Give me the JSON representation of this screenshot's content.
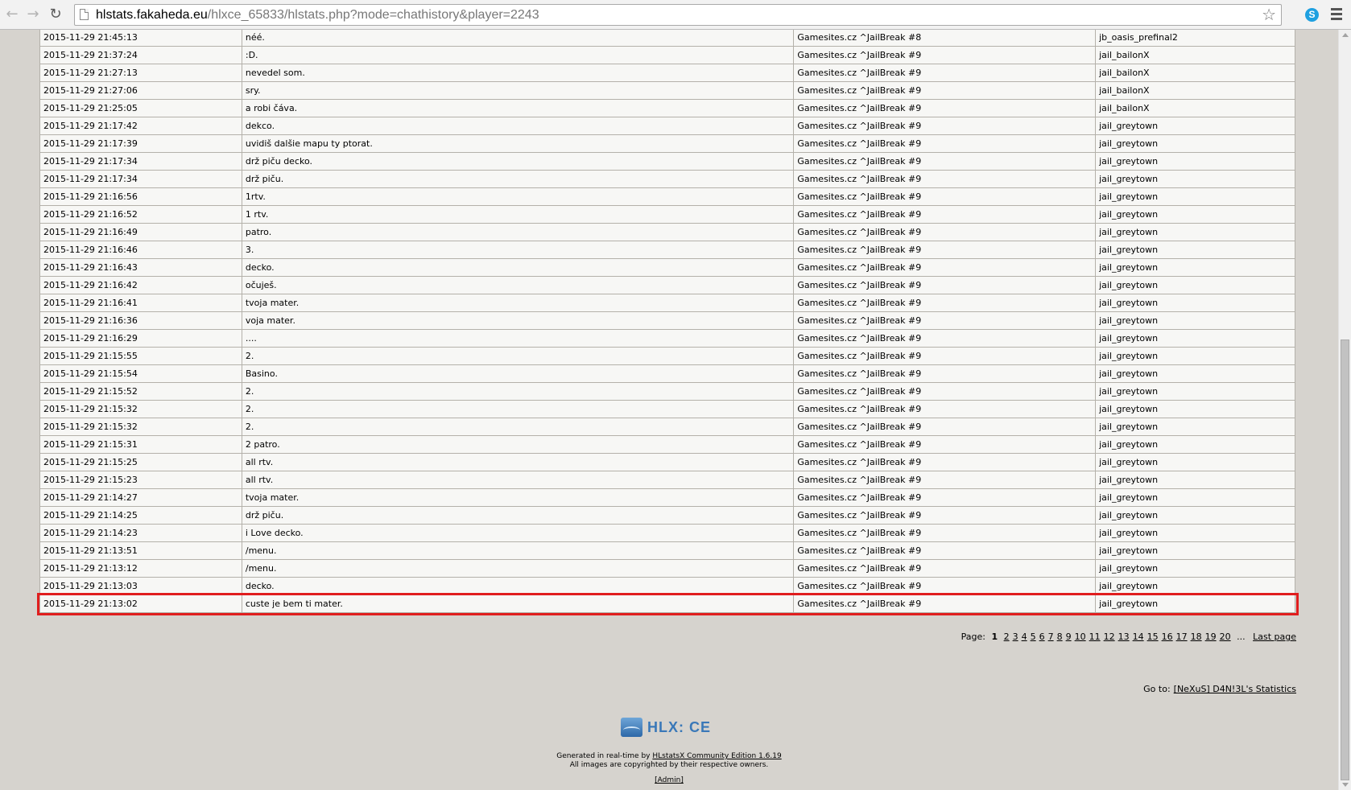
{
  "browser": {
    "url_host": "hlstats.fakaheda.eu",
    "url_path": "/hlxce_65833/hlstats.php?mode=chathistory&player=2243",
    "back_icon": "back-arrow-icon",
    "forward_icon": "forward-arrow-icon",
    "reload_icon": "reload-icon",
    "bookmark_icon": "star-icon",
    "extension_icon": "skype-icon",
    "menu_icon": "hamburger-menu-icon",
    "skype_letter": "S"
  },
  "chat_rows": [
    {
      "date": "2015-11-29 21:45:13",
      "message": "néé.",
      "server": "Gamesites.cz ^JailBreak #8",
      "map": "jb_oasis_prefinal2"
    },
    {
      "date": "2015-11-29 21:37:24",
      "message": ":D.",
      "server": "Gamesites.cz ^JailBreak #9",
      "map": "jail_bailonX"
    },
    {
      "date": "2015-11-29 21:27:13",
      "message": "nevedel som.",
      "server": "Gamesites.cz ^JailBreak #9",
      "map": "jail_bailonX"
    },
    {
      "date": "2015-11-29 21:27:06",
      "message": "sry.",
      "server": "Gamesites.cz ^JailBreak #9",
      "map": "jail_bailonX"
    },
    {
      "date": "2015-11-29 21:25:05",
      "message": "a robi čáva.",
      "server": "Gamesites.cz ^JailBreak #9",
      "map": "jail_bailonX"
    },
    {
      "date": "2015-11-29 21:17:42",
      "message": "dekco.",
      "server": "Gamesites.cz ^JailBreak #9",
      "map": "jail_greytown"
    },
    {
      "date": "2015-11-29 21:17:39",
      "message": "uvidiš dalšie mapu ty ptorat.",
      "server": "Gamesites.cz ^JailBreak #9",
      "map": "jail_greytown"
    },
    {
      "date": "2015-11-29 21:17:34",
      "message": "drž piču decko.",
      "server": "Gamesites.cz ^JailBreak #9",
      "map": "jail_greytown"
    },
    {
      "date": "2015-11-29 21:17:34",
      "message": "drž piču.",
      "server": "Gamesites.cz ^JailBreak #9",
      "map": "jail_greytown"
    },
    {
      "date": "2015-11-29 21:16:56",
      "message": "1rtv.",
      "server": "Gamesites.cz ^JailBreak #9",
      "map": "jail_greytown"
    },
    {
      "date": "2015-11-29 21:16:52",
      "message": "1 rtv.",
      "server": "Gamesites.cz ^JailBreak #9",
      "map": "jail_greytown"
    },
    {
      "date": "2015-11-29 21:16:49",
      "message": "patro.",
      "server": "Gamesites.cz ^JailBreak #9",
      "map": "jail_greytown"
    },
    {
      "date": "2015-11-29 21:16:46",
      "message": "3.",
      "server": "Gamesites.cz ^JailBreak #9",
      "map": "jail_greytown"
    },
    {
      "date": "2015-11-29 21:16:43",
      "message": "decko.",
      "server": "Gamesites.cz ^JailBreak #9",
      "map": "jail_greytown"
    },
    {
      "date": "2015-11-29 21:16:42",
      "message": "očuješ.",
      "server": "Gamesites.cz ^JailBreak #9",
      "map": "jail_greytown"
    },
    {
      "date": "2015-11-29 21:16:41",
      "message": "tvoja mater.",
      "server": "Gamesites.cz ^JailBreak #9",
      "map": "jail_greytown"
    },
    {
      "date": "2015-11-29 21:16:36",
      "message": "voja mater.",
      "server": "Gamesites.cz ^JailBreak #9",
      "map": "jail_greytown"
    },
    {
      "date": "2015-11-29 21:16:29",
      "message": "....",
      "server": "Gamesites.cz ^JailBreak #9",
      "map": "jail_greytown"
    },
    {
      "date": "2015-11-29 21:15:55",
      "message": "2.",
      "server": "Gamesites.cz ^JailBreak #9",
      "map": "jail_greytown"
    },
    {
      "date": "2015-11-29 21:15:54",
      "message": "Basino.",
      "server": "Gamesites.cz ^JailBreak #9",
      "map": "jail_greytown"
    },
    {
      "date": "2015-11-29 21:15:52",
      "message": "2.",
      "server": "Gamesites.cz ^JailBreak #9",
      "map": "jail_greytown"
    },
    {
      "date": "2015-11-29 21:15:32",
      "message": "2.",
      "server": "Gamesites.cz ^JailBreak #9",
      "map": "jail_greytown"
    },
    {
      "date": "2015-11-29 21:15:32",
      "message": "2.",
      "server": "Gamesites.cz ^JailBreak #9",
      "map": "jail_greytown"
    },
    {
      "date": "2015-11-29 21:15:31",
      "message": "2 patro.",
      "server": "Gamesites.cz ^JailBreak #9",
      "map": "jail_greytown"
    },
    {
      "date": "2015-11-29 21:15:25",
      "message": "all rtv.",
      "server": "Gamesites.cz ^JailBreak #9",
      "map": "jail_greytown"
    },
    {
      "date": "2015-11-29 21:15:23",
      "message": "all rtv.",
      "server": "Gamesites.cz ^JailBreak #9",
      "map": "jail_greytown"
    },
    {
      "date": "2015-11-29 21:14:27",
      "message": "tvoja mater.",
      "server": "Gamesites.cz ^JailBreak #9",
      "map": "jail_greytown"
    },
    {
      "date": "2015-11-29 21:14:25",
      "message": "drž piču.",
      "server": "Gamesites.cz ^JailBreak #9",
      "map": "jail_greytown"
    },
    {
      "date": "2015-11-29 21:14:23",
      "message": "i Love decko.",
      "server": "Gamesites.cz ^JailBreak #9",
      "map": "jail_greytown"
    },
    {
      "date": "2015-11-29 21:13:51",
      "message": "/menu.",
      "server": "Gamesites.cz ^JailBreak #9",
      "map": "jail_greytown"
    },
    {
      "date": "2015-11-29 21:13:12",
      "message": "/menu.",
      "server": "Gamesites.cz ^JailBreak #9",
      "map": "jail_greytown"
    },
    {
      "date": "2015-11-29 21:13:03",
      "message": "decko.",
      "server": "Gamesites.cz ^JailBreak #9",
      "map": "jail_greytown"
    },
    {
      "date": "2015-11-29 21:13:02",
      "message": "custe je bem ti mater.",
      "server": "Gamesites.cz ^JailBreak #9",
      "map": "jail_greytown",
      "highlighted": true
    }
  ],
  "pagination": {
    "label": "Page:",
    "current": "1",
    "pages": [
      "2",
      "3",
      "4",
      "5",
      "6",
      "7",
      "8",
      "9",
      "10",
      "11",
      "12",
      "13",
      "14",
      "15",
      "16",
      "17",
      "18",
      "19",
      "20"
    ],
    "ellipsis": "...",
    "last_label": "Last page"
  },
  "goto": {
    "label": "Go to:",
    "link": "[NeXuS] D4N!3L's Statistics"
  },
  "footer": {
    "logo_text": "HLX: CE",
    "logo_icon": "hlx-logo-icon",
    "generated_prefix": "Generated in real-time by",
    "generated_link": "HLstatsX Community Edition 1.6.19",
    "copyright": "All images are copyrighted by their respective owners.",
    "admin_link": "[Admin]"
  },
  "colors": {
    "highlight": "#e01e1e",
    "page_bg": "#d6d3ce",
    "table_bg": "#f7f7f5",
    "logo_blue": "#3a78b8"
  }
}
